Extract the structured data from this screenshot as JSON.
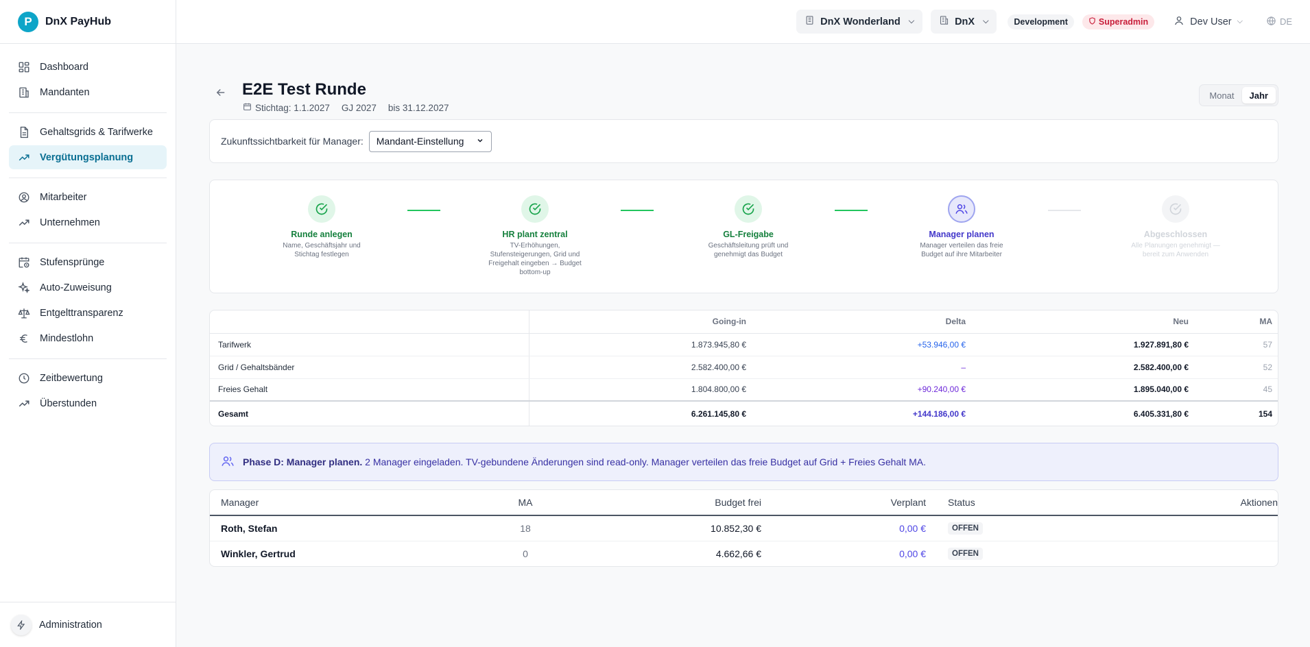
{
  "app": {
    "logo_letter": "P",
    "name": "DnX PayHub"
  },
  "sidebar": {
    "groups": [
      [
        {
          "label": "Dashboard",
          "icon": "grid-icon"
        },
        {
          "label": "Mandanten",
          "icon": "building-icon"
        }
      ],
      [
        {
          "label": "Gehaltsgrids & Tarifwerke",
          "icon": "document-icon"
        },
        {
          "label": "Vergütungsplanung",
          "icon": "trend-icon",
          "active": true
        }
      ],
      [
        {
          "label": "Mitarbeiter",
          "icon": "user-circle-icon"
        },
        {
          "label": "Unternehmen",
          "icon": "trend-icon"
        }
      ],
      [
        {
          "label": "Stufensprünge",
          "icon": "calendar-clock-icon"
        },
        {
          "label": "Auto-Zuweisung",
          "icon": "sparkles-icon"
        },
        {
          "label": "Entgelttransparenz",
          "icon": "scale-icon"
        },
        {
          "label": "Mindestlohn",
          "icon": "euro-icon"
        }
      ],
      [
        {
          "label": "Zeitbewertung",
          "icon": "clock-icon"
        },
        {
          "label": "Überstunden",
          "icon": "trend-icon"
        }
      ]
    ],
    "footer": {
      "label": "Administration"
    }
  },
  "topbar": {
    "tenant": "DnX Wonderland",
    "company": "DnX",
    "env_badge": "Development",
    "role_badge": "Superadmin",
    "user": "Dev User",
    "lang": "DE"
  },
  "page": {
    "title": "E2E Test Runde",
    "stichtag": "Stichtag: 1.1.2027",
    "gj": "GJ 2027",
    "until": "bis 31.12.2027",
    "view_toggle": {
      "month": "Monat",
      "year": "Jahr",
      "selected": "Jahr"
    }
  },
  "visibility": {
    "label": "Zukunftssichtbarkeit für Manager:",
    "selected": "Mandant-Einstellung"
  },
  "steps": [
    {
      "title": "Runde anlegen",
      "desc": "Name, Geschäftsjahr und Stichtag festlegen",
      "state": "done"
    },
    {
      "title": "HR plant zentral",
      "desc": "TV-Erhöhungen, Stufensteigerungen, Grid und Freigehalt eingeben → Budget bottom-up",
      "state": "done"
    },
    {
      "title": "GL-Freigabe",
      "desc": "Geschäftsleitung prüft und genehmigt das Budget",
      "state": "done"
    },
    {
      "title": "Manager planen",
      "desc": "Manager verteilen das freie Budget auf ihre Mitarbeiter",
      "state": "current"
    },
    {
      "title": "Abgeschlossen",
      "desc": "Alle Planungen genehmigt — bereit zum Anwenden",
      "state": "pending"
    }
  ],
  "totals": {
    "headers": [
      "",
      "Going-in",
      "Delta",
      "Neu",
      "MA"
    ],
    "rows": [
      {
        "label": "Tarifwerk",
        "going_in": "1.873.945,80 €",
        "delta": "+53.946,00 €",
        "neu": "1.927.891,80 €",
        "ma": "57"
      },
      {
        "label": "Grid / Gehaltsbänder",
        "going_in": "2.582.400,00 €",
        "delta": "–",
        "neu": "2.582.400,00 €",
        "ma": "52"
      },
      {
        "label": "Freies Gehalt",
        "going_in": "1.804.800,00 €",
        "delta": "+90.240,00 €",
        "neu": "1.895.040,00 €",
        "ma": "45"
      }
    ],
    "sum": {
      "label": "Gesamt",
      "going_in": "6.261.145,80 €",
      "delta": "+144.186,00 €",
      "neu": "6.405.331,80 €",
      "ma": "154"
    }
  },
  "phase": {
    "bold": "Phase D: Manager planen.",
    "text": "2 Manager eingeladen. TV-gebundene Änderungen sind read-only. Manager verteilen das freie Budget auf Grid + Freies Gehalt MA."
  },
  "managers": {
    "headers": {
      "manager": "Manager",
      "ma": "MA",
      "budget": "Budget frei",
      "planned": "Verplant",
      "status": "Status",
      "actions": "Aktionen"
    },
    "rows": [
      {
        "name": "Roth, Stefan",
        "ma": "18",
        "budget": "10.852,30 €",
        "planned": "0,00 €",
        "status": "OFFEN"
      },
      {
        "name": "Winkler, Gertrud",
        "ma": "0",
        "budget": "4.662,66 €",
        "planned": "0,00 €",
        "status": "OFFEN"
      }
    ]
  }
}
